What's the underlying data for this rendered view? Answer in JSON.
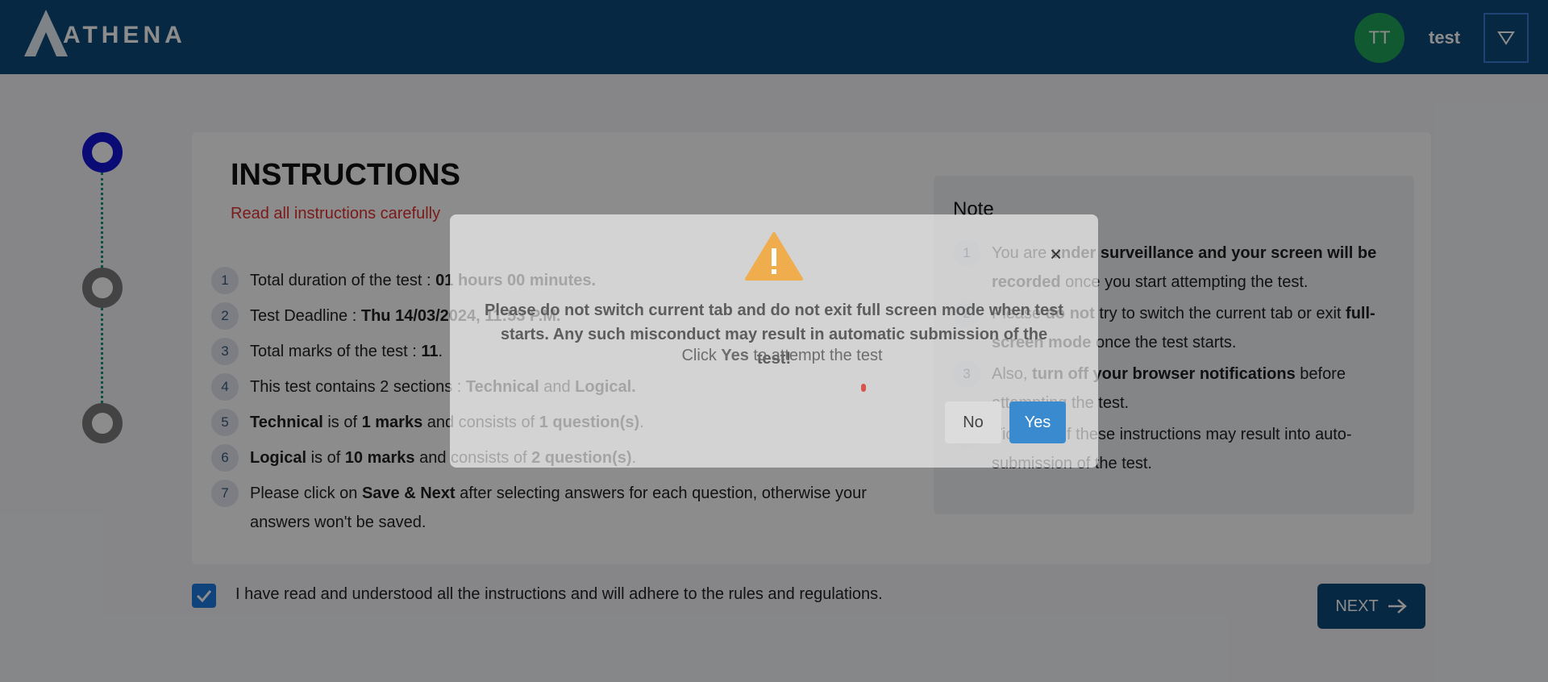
{
  "header": {
    "brand": "ATHENA",
    "avatar_initials": "TT",
    "user_name": "test"
  },
  "instructions": {
    "title": "INSTRUCTIONS",
    "subtitle": "Read all instructions carefully",
    "items": [
      {
        "num": "1",
        "parts": [
          [
            "Total duration of the test : ",
            false
          ],
          [
            "01 hours 00 minutes.",
            true
          ]
        ]
      },
      {
        "num": "2",
        "parts": [
          [
            "Test Deadline : ",
            false
          ],
          [
            "Thu 14/03/2024, 11:53 P.M.",
            true
          ]
        ]
      },
      {
        "num": "3",
        "parts": [
          [
            "Total marks of the test : ",
            false
          ],
          [
            "11",
            true
          ],
          [
            ".",
            false
          ]
        ]
      },
      {
        "num": "4",
        "parts": [
          [
            "This test contains 2 sections : ",
            false
          ],
          [
            "Technical",
            true
          ],
          [
            " and ",
            false
          ],
          [
            "Logical.",
            true
          ]
        ]
      },
      {
        "num": "5",
        "parts": [
          [
            "Technical",
            true
          ],
          [
            " is of ",
            false
          ],
          [
            "1 marks",
            true
          ],
          [
            " and consists of ",
            false
          ],
          [
            "1 question(s)",
            true
          ],
          [
            ".",
            false
          ]
        ]
      },
      {
        "num": "6",
        "parts": [
          [
            "Logical",
            true
          ],
          [
            " is of ",
            false
          ],
          [
            "10 marks",
            true
          ],
          [
            " and consists of ",
            false
          ],
          [
            "2 question(s)",
            true
          ],
          [
            ".",
            false
          ]
        ]
      },
      {
        "num": "7",
        "parts": [
          [
            "Please click on ",
            false
          ],
          [
            "Save & Next",
            true
          ],
          [
            " after selecting answers for each question, otherwise your answers won't be saved.",
            false
          ]
        ]
      }
    ]
  },
  "note": {
    "title": "Note",
    "items": [
      {
        "num": "1",
        "parts": [
          [
            "You are ",
            false
          ],
          [
            "under surveillance and your screen will be recorded",
            true
          ],
          [
            " once you start attempting the test.",
            false
          ]
        ]
      },
      {
        "num": "2",
        "parts": [
          [
            "Please ",
            false
          ],
          [
            "do not",
            true
          ],
          [
            " try to switch the current tab or exit ",
            false
          ],
          [
            "full-screen mode",
            true
          ],
          [
            " once the test starts.",
            false
          ]
        ]
      },
      {
        "num": "3",
        "parts": [
          [
            "Also, ",
            false
          ],
          [
            "turn off your browser notifications",
            true
          ],
          [
            " before attempting the test.",
            false
          ]
        ]
      },
      {
        "num": "4",
        "parts": [
          [
            "Violation of these instructions may result into auto-submission of the test.",
            false
          ]
        ]
      }
    ]
  },
  "agreement": {
    "text": "I have read and understood all the instructions and will adhere to the rules and regulations.",
    "checked": true
  },
  "next_button": {
    "label": "NEXT"
  },
  "modal": {
    "message": "Please do not switch current tab and do not exit full screen mode when test starts. Any such misconduct may result in automatic submission of the test!",
    "click_prefix": "Click ",
    "click_bold": "Yes",
    "click_suffix": " to attempt the test",
    "no_label": "No",
    "yes_label": "Yes",
    "close_symbol": "×"
  },
  "colors": {
    "header_bg": "#0d4a7a",
    "avatar_bg": "#1fa55a",
    "active_step": "#1414d6",
    "inactive_step": "#7a7a7a",
    "subtitle_red": "#e03030",
    "warning": "#f0ad4e",
    "yes_button": "#3a8ad0"
  }
}
